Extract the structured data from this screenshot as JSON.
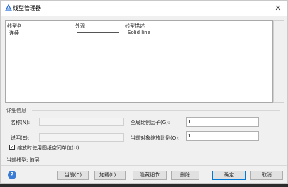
{
  "window": {
    "title": "线型管理器",
    "close_icon": "close-icon"
  },
  "linetype_list": {
    "columns": [
      "线型名",
      "外观",
      "线型描述"
    ],
    "rows": [
      {
        "name": "连续",
        "description": "Solid line"
      }
    ]
  },
  "details": {
    "group_label": "详细信息",
    "name_label": "名称(N):",
    "name_value": "",
    "description_label": "说明(E):",
    "description_value": "",
    "global_scale_label": "全局比例因子(G):",
    "global_scale_value": "1",
    "object_scale_label": "当前对象缩放比例(O):",
    "object_scale_value": "1",
    "paper_space_label": "缩放时使用图纸空间单位(U)",
    "paper_space_checked": true
  },
  "current_linetype": "当前线型: 随层",
  "buttons": {
    "help": "?",
    "current": "当前(C)",
    "load": "加载(L)...",
    "hide_details": "隐藏细节",
    "delete": "删除",
    "ok": "确定",
    "cancel": "取消"
  },
  "colors": {
    "help_blue": "#3a7bd5",
    "focus_border": "#0078d7"
  }
}
